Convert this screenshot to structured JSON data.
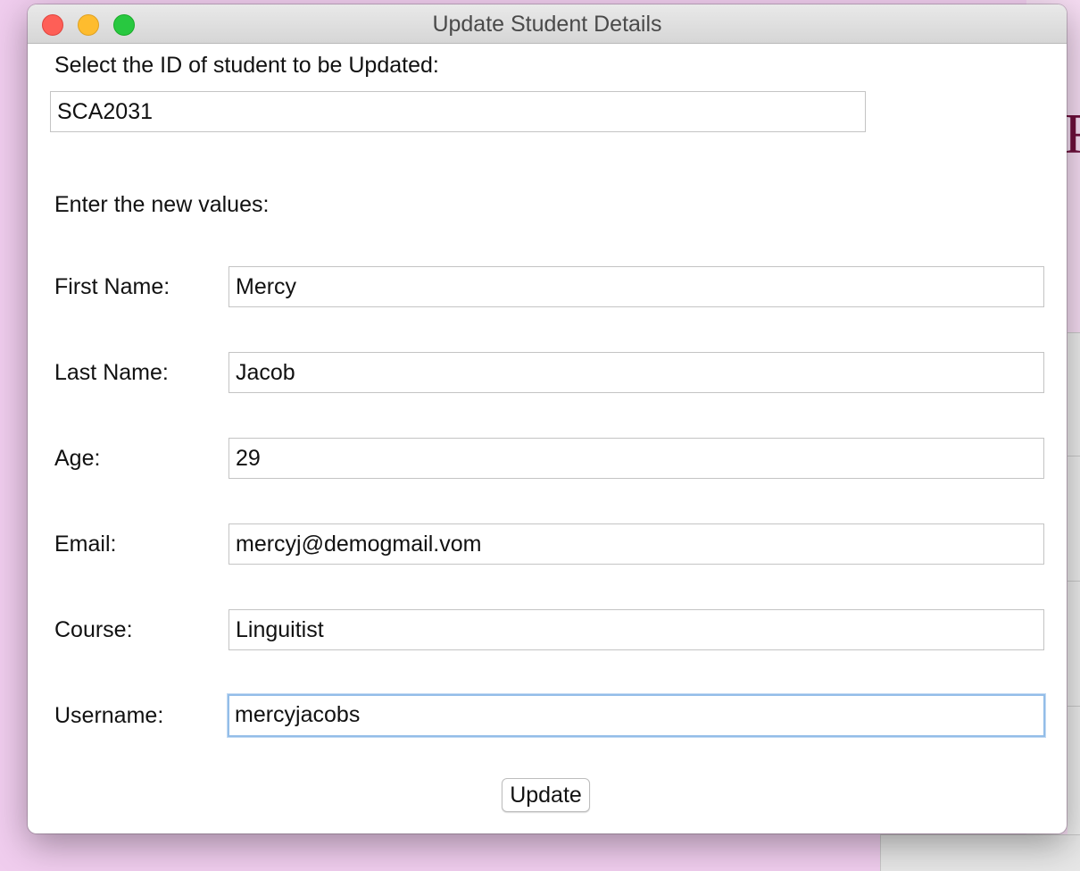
{
  "window": {
    "title": "Update Student Details"
  },
  "background": {
    "partial_letter": "R"
  },
  "form": {
    "select_prompt": "Select the ID of student to be Updated:",
    "student_id": "SCA2031",
    "new_values_prompt": "Enter the new values:",
    "fields": [
      {
        "label": "First Name:",
        "value": "Mercy"
      },
      {
        "label": "Last Name:",
        "value": "Jacob"
      },
      {
        "label": "Age:",
        "value": "29"
      },
      {
        "label": "Email:",
        "value": "mercyj@demogmail.vom"
      },
      {
        "label": "Course:",
        "value": "Linguitist"
      },
      {
        "label": "Username:",
        "value": "mercyjacobs",
        "focused": true
      }
    ],
    "update_button": "Update"
  },
  "colors": {
    "close": "#fe5f57",
    "minimize": "#febc2e",
    "maximize": "#28c840",
    "focus_ring": "#93bde8",
    "desktop": "#f0cdee"
  }
}
